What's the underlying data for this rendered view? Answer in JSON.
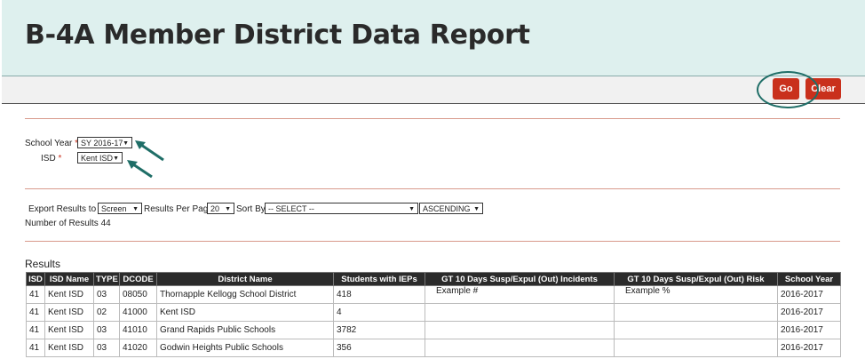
{
  "header": {
    "title": "B-4A Member District Data Report"
  },
  "toolbar": {
    "go_label": "Go",
    "clear_label": "Clear"
  },
  "filters": {
    "school_year_label": "School Year",
    "school_year_value": "SY 2016-17",
    "isd_label": "ISD",
    "isd_value": "Kent ISD",
    "required_mark": "*"
  },
  "export": {
    "export_label": "Export Results to",
    "export_value": "Screen",
    "per_page_label": "Results Per Page",
    "per_page_value": "20",
    "sort_by_label": "Sort By",
    "sort_by_value": "-- SELECT --",
    "order_value": "ASCENDING",
    "num_results_label": "Number of Results",
    "num_results_value": "44"
  },
  "results": {
    "title": "Results",
    "columns": [
      "ISD",
      "ISD Name",
      "TYPE",
      "DCODE",
      "District Name",
      "Students with IEPs",
      "GT 10 Days Susp/Expul (Out) Incidents",
      "GT 10 Days Susp/Expul (Out) Risk",
      "School Year"
    ],
    "rows": [
      [
        "41",
        "Kent ISD",
        "03",
        "08050",
        "Thornapple Kellogg School District",
        "418",
        "Example #",
        "Example %",
        "2016-2017"
      ],
      [
        "41",
        "Kent ISD",
        "02",
        "41000",
        "Kent ISD",
        "4",
        "",
        "",
        "2016-2017"
      ],
      [
        "41",
        "Kent ISD",
        "03",
        "41010",
        "Grand Rapids Public Schools",
        "3782",
        "",
        "",
        "2016-2017"
      ],
      [
        "41",
        "Kent ISD",
        "03",
        "41020",
        "Godwin Heights Public Schools",
        "356",
        "",
        "",
        "2016-2017"
      ]
    ]
  },
  "colors": {
    "accent_red": "#c9301c",
    "header_bg": "#def0ee",
    "annotation_teal": "#1f6e67"
  },
  "icons": {
    "dropdown": "chevron-down-icon",
    "annotation": "arrow-icon"
  }
}
